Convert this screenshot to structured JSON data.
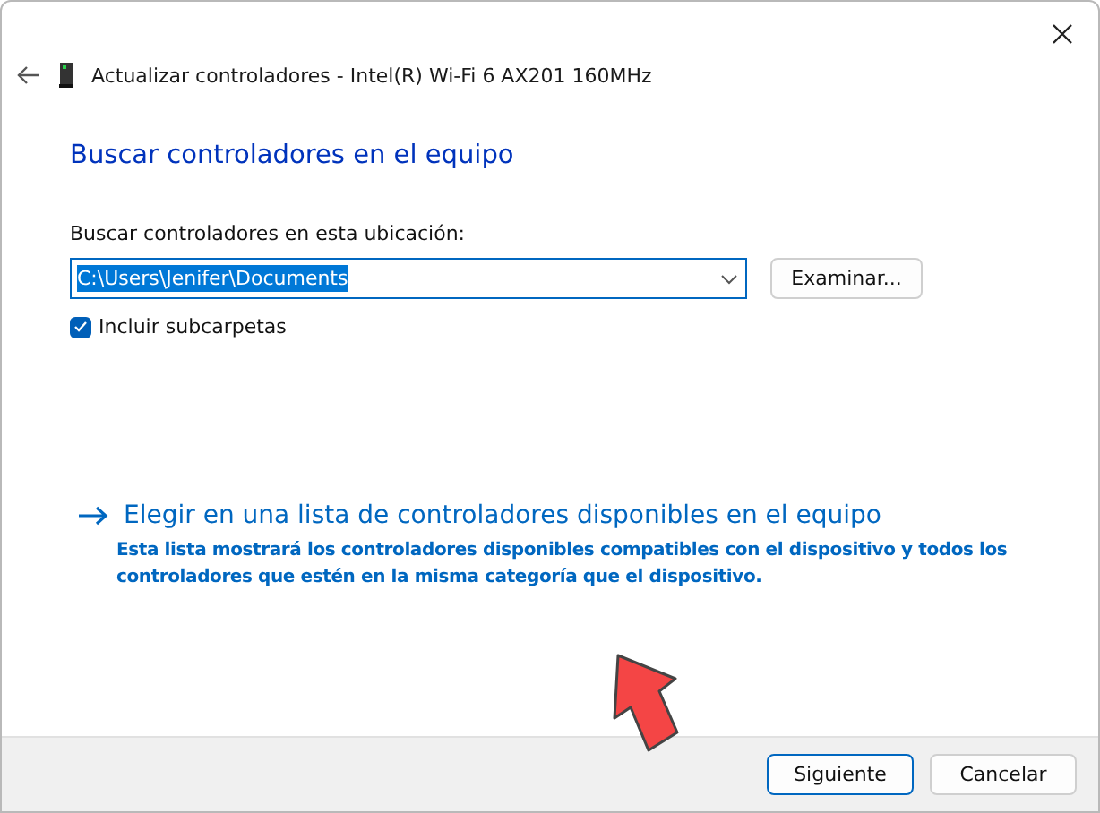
{
  "window": {
    "title": "Actualizar controladores - Intel(R) Wi-Fi 6 AX201 160MHz"
  },
  "heading": "Buscar controladores en el equipo",
  "location": {
    "label": "Buscar controladores en esta ubicación:",
    "value": "C:\\Users\\Jenifer\\Documents",
    "browse_button": "Examinar..."
  },
  "include_subfolders": {
    "label": "Incluir subcarpetas",
    "checked": true
  },
  "pick_option": {
    "title": "Elegir en una lista de controladores disponibles en el equipo",
    "description": "Esta lista mostrará los controladores disponibles compatibles con el dispositivo y todos los controladores que estén en la misma categoría que el dispositivo."
  },
  "buttons": [
    {
      "label": "Siguiente",
      "primary": true
    },
    {
      "label": "Cancelar",
      "primary": false
    }
  ]
}
